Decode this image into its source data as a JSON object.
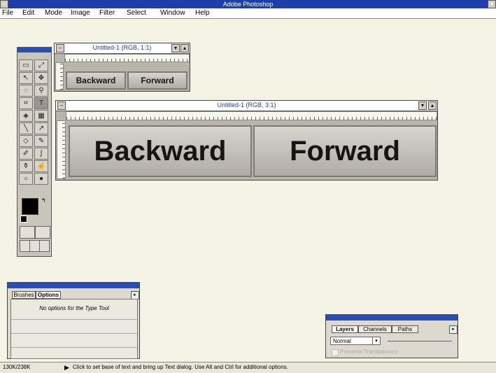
{
  "app": {
    "title": "Adobe Photoshop"
  },
  "menu": [
    "File",
    "Edit",
    "Mode",
    "Image",
    "Filter",
    "Select",
    "Window",
    "Help"
  ],
  "small_doc": {
    "title": "Untitled-1  (RGB, 1:1)",
    "back_label": "Backward",
    "fwd_label": "Forward"
  },
  "large_doc": {
    "title": "Untitled-1  (RGB, 3:1)",
    "back_label": "Backward",
    "fwd_label": "Forward"
  },
  "options_palette": {
    "tabs": [
      "Brushes",
      "Options"
    ],
    "message": "No options for the Type Tool"
  },
  "layers_palette": {
    "tabs": [
      "Layers",
      "Channels",
      "Paths"
    ],
    "mode": "Normal",
    "checkbox_label": "Preserve Transparency"
  },
  "status": {
    "size": "130K/238K",
    "hint": "Click to set base of text and bring up Text dialog. Use Alt and Ctrl for additional options."
  },
  "colors": {
    "title_blue": "#1f3fa8",
    "desktop": "#f5f3e6"
  }
}
